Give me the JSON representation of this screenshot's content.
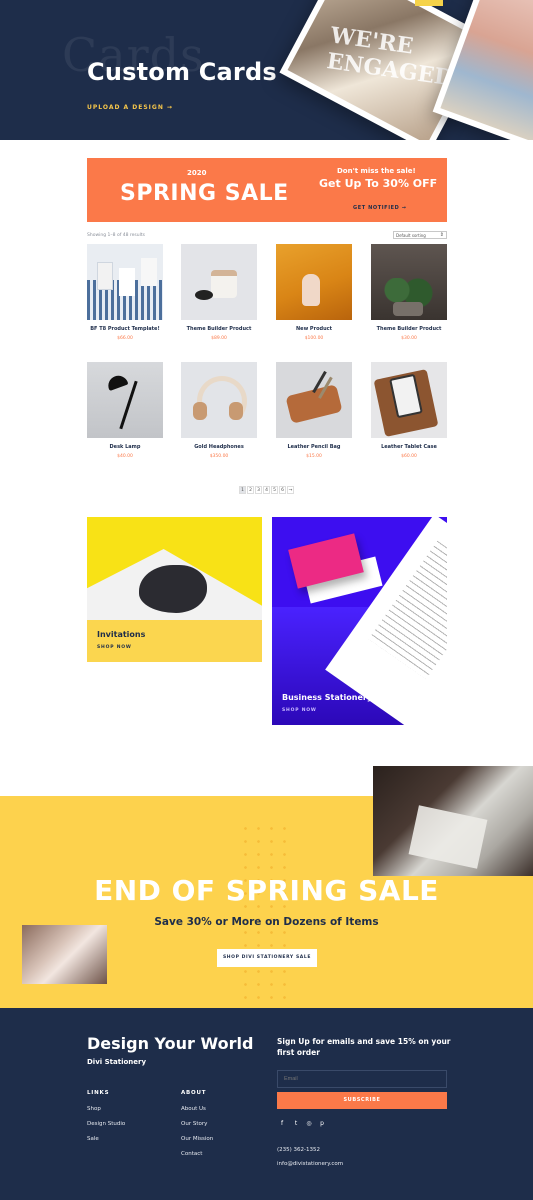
{
  "hero": {
    "ghost_text": "Cards",
    "title": "Custom Cards",
    "link": "UPLOAD A DESIGN →",
    "photo_text": "WE'RE ENGAGED"
  },
  "banner": {
    "year": "2020",
    "sale": "SPRING SALE",
    "dont_miss": "Don't miss the sale!",
    "offer": "Get Up To 30% OFF",
    "cta": "GET NOTIFIED →"
  },
  "shop": {
    "results": "Showing 1–8 of 48 results",
    "sort": "Default sorting",
    "products": [
      {
        "name": "BF T8 Product Template!",
        "price": "$66.00"
      },
      {
        "name": "Theme Builder Product",
        "price": "$89.00"
      },
      {
        "name": "New Product",
        "price": "$100.00"
      },
      {
        "name": "Theme Builder Product",
        "price": "$30.00"
      },
      {
        "name": "Desk Lamp",
        "price": "$40.00"
      },
      {
        "name": "Gold Headphones",
        "price": "$350.00"
      },
      {
        "name": "Leather Pencil Bag",
        "price": "$15.00"
      },
      {
        "name": "Leather Tablet Case",
        "price": "$60.00"
      }
    ],
    "pagination": [
      "1",
      "2",
      "3",
      "4",
      "5",
      "6",
      "→"
    ]
  },
  "categories": {
    "invitations": {
      "label": "Invitations",
      "cta": "SHOP NOW"
    },
    "business": {
      "label": "Business Stationery",
      "cta": "SHOP NOW"
    }
  },
  "promo": {
    "headline": "END OF SPRING SALE",
    "sub": "Save 30% or More on Dozens of Items",
    "cta": "SHOP DIVI STATIONERY SALE"
  },
  "footer": {
    "brand": "Design Your World",
    "brand_sub": "Divi Stationery",
    "links_head": "LINKS",
    "links": [
      "Shop",
      "Design Studio",
      "Sale"
    ],
    "about_head": "ABOUT",
    "about": [
      "About Us",
      "Our Story",
      "Our Mission",
      "Contact"
    ],
    "signup": "Sign Up for emails and save 15% on your first order",
    "email_placeholder": "Email",
    "subscribe": "SUBSCRIBE",
    "social": [
      "f",
      "t",
      "◎",
      "p"
    ],
    "phone": "(235) 362-1352",
    "email": "info@divistationery.com"
  },
  "colors": {
    "navy": "#1e2d4a",
    "orange": "#fb7949",
    "yellow": "#fdd24d",
    "purple": "#3d0ef0"
  }
}
